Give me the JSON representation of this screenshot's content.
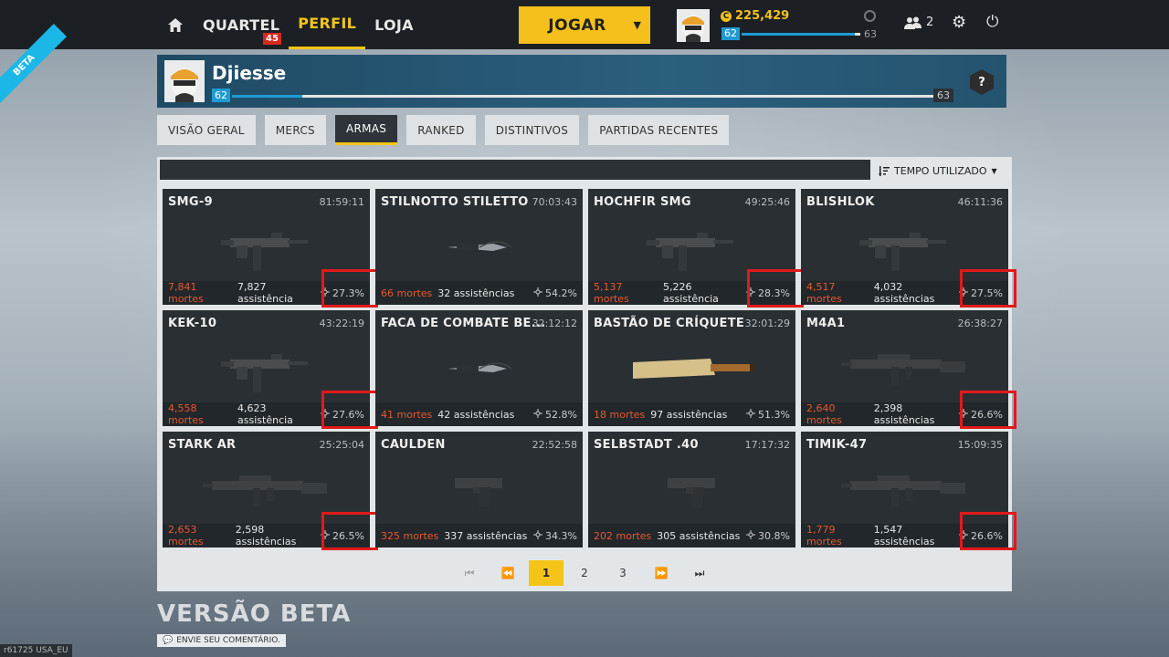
{
  "topbar": {
    "nav": [
      {
        "label": "QUARTEL",
        "badge": "45",
        "active": false
      },
      {
        "label": "PERFIL",
        "active": true
      },
      {
        "label": "LOJA",
        "active": false
      }
    ],
    "play_label": "JOGAR",
    "credits": "225,429",
    "level": "62",
    "next_level": "63",
    "xp_progress": 0.95,
    "friends_count": "2"
  },
  "ribbon": "BETA",
  "profile": {
    "name": "Djiesse",
    "level": "62",
    "next_level": "63",
    "xp_progress": 0.1,
    "rank_symbol": "?"
  },
  "tabs": [
    "VISÃO GERAL",
    "MERCS",
    "ARMAS",
    "RANKED",
    "DISTINTIVOS",
    "PARTIDAS RECENTES"
  ],
  "active_tab": "ARMAS",
  "sort_label": "TEMPO UTILIZADO",
  "weapons": [
    {
      "name": "SMG-9",
      "time": "81:59:11",
      "kills": "7,841 mortes",
      "assists": "7,827 assistência",
      "accuracy": "27.3%",
      "icon": "smg-icon",
      "highlight": true
    },
    {
      "name": "STILNOTTO STILETTO",
      "time": "70:03:43",
      "kills": "66 mortes",
      "assists": "32 assistências",
      "accuracy": "54.2%",
      "icon": "knife-icon",
      "highlight": false
    },
    {
      "name": "HOCHFIR SMG",
      "time": "49:25:46",
      "kills": "5,137 mortes",
      "assists": "5,226 assistência",
      "accuracy": "28.3%",
      "icon": "smg-icon",
      "highlight": true
    },
    {
      "name": "BLISHLOK",
      "time": "46:11:36",
      "kills": "4,517 mortes",
      "assists": "4,032 assistências",
      "accuracy": "27.5%",
      "icon": "smg-icon",
      "highlight": true
    },
    {
      "name": "KEK-10",
      "time": "43:22:19",
      "kills": "4,558 mortes",
      "assists": "4,623 assistência",
      "accuracy": "27.6%",
      "icon": "smg-icon",
      "highlight": true
    },
    {
      "name": "FACA DE COMBATE BE...",
      "time": "32:12:12",
      "kills": "41 mortes",
      "assists": "42 assistências",
      "accuracy": "52.8%",
      "icon": "knife-icon",
      "highlight": false
    },
    {
      "name": "BASTÃO DE CRÍQUETE",
      "time": "32:01:29",
      "kills": "18 mortes",
      "assists": "97 assistências",
      "accuracy": "51.3%",
      "icon": "bat-icon",
      "highlight": false
    },
    {
      "name": "M4A1",
      "time": "26:38:27",
      "kills": "2,640 mortes",
      "assists": "2,398 assistências",
      "accuracy": "26.6%",
      "icon": "rifle-icon",
      "highlight": true
    },
    {
      "name": "STARK AR",
      "time": "25:25:04",
      "kills": "2,653 mortes",
      "assists": "2,598 assistências",
      "accuracy": "26.5%",
      "icon": "rifle-icon",
      "highlight": true
    },
    {
      "name": "CAULDEN",
      "time": "22:52:58",
      "kills": "325 mortes",
      "assists": "337 assistências",
      "accuracy": "34.3%",
      "icon": "pistol-icon",
      "highlight": false
    },
    {
      "name": "SELBSTADT .40",
      "time": "17:17:32",
      "kills": "202 mortes",
      "assists": "305 assistências",
      "accuracy": "30.8%",
      "icon": "pistol-icon",
      "highlight": false
    },
    {
      "name": "TIMIK-47",
      "time": "15:09:35",
      "kills": "1,779 mortes",
      "assists": "1,547 assistências",
      "accuracy": "26.6%",
      "icon": "rifle-icon",
      "highlight": true
    }
  ],
  "pagination": {
    "pages": [
      "1",
      "2",
      "3"
    ],
    "current": "1"
  },
  "footer": {
    "title": "VERSÃO BETA",
    "feedback": "ENVIE SEU COMENTÁRIO.",
    "build": "r61725 USA_EU"
  },
  "colors": {
    "accent": "#f5c419",
    "xp": "#1e9ad4",
    "kills": "#e8572c",
    "highlight": "#e01a1a"
  }
}
